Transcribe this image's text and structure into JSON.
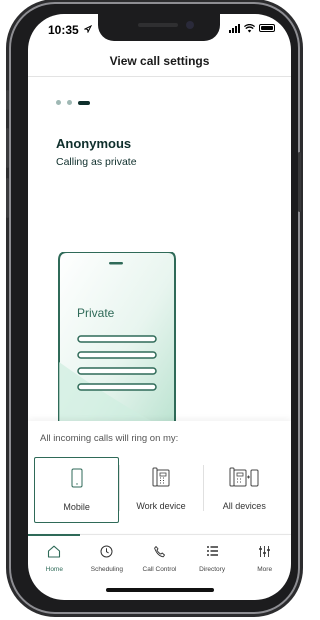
{
  "status_bar": {
    "time": "10:35"
  },
  "header": {
    "title": "View call settings"
  },
  "pager": {
    "total": 3,
    "active_index": 2
  },
  "content": {
    "title": "Anonymous",
    "subtitle": "Calling as private",
    "illustration_label": "Private"
  },
  "sheet": {
    "title": "All incoming calls will ring on my:",
    "options": [
      {
        "label": "Mobile",
        "icon": "mobile-phone-icon",
        "selected": true
      },
      {
        "label": "Work device",
        "icon": "desk-phone-icon",
        "selected": false
      },
      {
        "label": "All devices",
        "icon": "all-devices-icon",
        "selected": false
      }
    ]
  },
  "tabs": [
    {
      "label": "Home",
      "icon": "home-icon",
      "active": true
    },
    {
      "label": "Scheduling",
      "icon": "clock-icon",
      "active": false
    },
    {
      "label": "Call Control",
      "icon": "phone-handset-icon",
      "active": false
    },
    {
      "label": "Directory",
      "icon": "list-icon",
      "active": false
    },
    {
      "label": "More",
      "icon": "sliders-icon",
      "active": false
    }
  ],
  "colors": {
    "brand": "#2f6a58",
    "dark_text": "#0f2f2c",
    "accent_light": "#9fd3c0"
  }
}
